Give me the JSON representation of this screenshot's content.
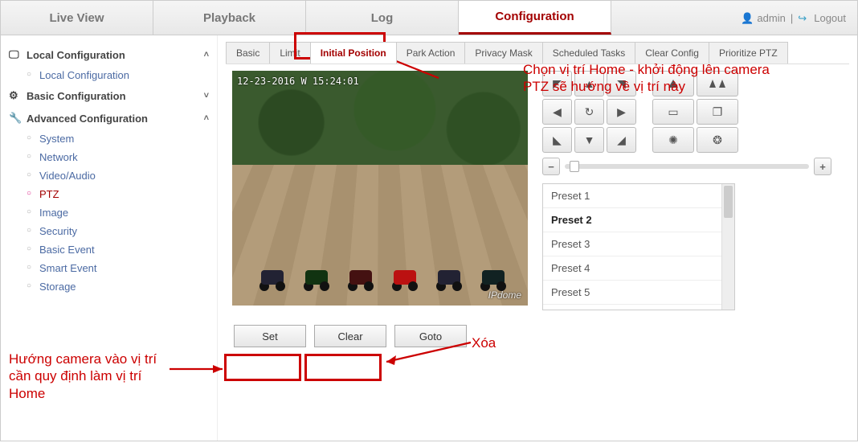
{
  "topnav": {
    "tabs": [
      "Live View",
      "Playback",
      "Log",
      "Configuration"
    ],
    "active": 3,
    "user": "admin",
    "logout": "Logout"
  },
  "sidebar": {
    "sections": [
      {
        "label": "Local Configuration",
        "expanded": true,
        "icon": "screen",
        "items": [
          "Local Configuration"
        ]
      },
      {
        "label": "Basic Configuration",
        "expanded": false,
        "icon": "gear",
        "items": []
      },
      {
        "label": "Advanced Configuration",
        "expanded": true,
        "icon": "wrench",
        "items": [
          "System",
          "Network",
          "Video/Audio",
          "PTZ",
          "Image",
          "Security",
          "Basic Event",
          "Smart Event",
          "Storage"
        ],
        "active": 3
      }
    ]
  },
  "subtabs": {
    "items": [
      "Basic",
      "Limit",
      "Initial Position",
      "Park Action",
      "Privacy Mask",
      "Scheduled Tasks",
      "Clear Config",
      "Prioritize PTZ"
    ],
    "active": 2
  },
  "video": {
    "timestamp": "12-23-2016  W  15:24:01",
    "brand": "IPdome"
  },
  "presets": {
    "items": [
      "Preset 1",
      "Preset 2",
      "Preset 3",
      "Preset 4",
      "Preset 5"
    ],
    "selected": 1
  },
  "buttons": {
    "set": "Set",
    "clear": "Clear",
    "goto": "Goto"
  },
  "annotations": {
    "top": "Chọn vị trí Home - khởi động lên camera PTZ sẽ hướng về vị trí này",
    "left": "Hướng camera vào vị trí cần quy định làm vị trí Home",
    "xoa": "Xóa"
  }
}
